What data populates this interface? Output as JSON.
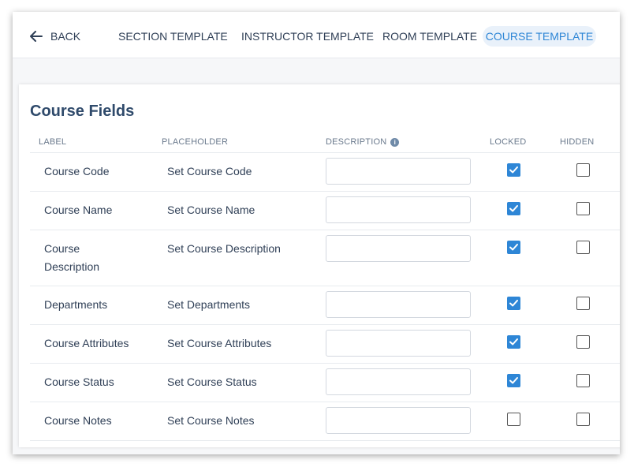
{
  "nav": {
    "back_label": "BACK",
    "tabs": [
      {
        "label": "SECTION TEMPLATE"
      },
      {
        "label": "INSTRUCTOR TEMPLATE"
      },
      {
        "label": "ROOM TEMPLATE"
      },
      {
        "label": "COURSE TEMPLATE",
        "active": true
      }
    ]
  },
  "card": {
    "title": "Course Fields",
    "columns": {
      "label": "LABEL",
      "placeholder": "PLACEHOLDER",
      "description": "DESCRIPTION",
      "locked": "LOCKED",
      "hidden": "HIDDEN"
    },
    "rows": [
      {
        "label": "Course Code",
        "placeholder": "Set Course Code",
        "description": "",
        "locked": true,
        "hidden": false
      },
      {
        "label": "Course Name",
        "placeholder": "Set Course Name",
        "description": "",
        "locked": true,
        "hidden": false
      },
      {
        "label": "Course Description",
        "placeholder": "Set Course Description",
        "description": "",
        "locked": true,
        "hidden": false
      },
      {
        "label": "Departments",
        "placeholder": "Set Departments",
        "description": "",
        "locked": true,
        "hidden": false
      },
      {
        "label": "Course Attributes",
        "placeholder": "Set Course Attributes",
        "description": "",
        "locked": true,
        "hidden": false
      },
      {
        "label": "Course Status",
        "placeholder": "Set Course Status",
        "description": "",
        "locked": true,
        "hidden": false
      },
      {
        "label": "Course Notes",
        "placeholder": "Set Course Notes",
        "description": "",
        "locked": false,
        "hidden": false
      }
    ]
  },
  "colors": {
    "accent": "#2e86d6",
    "active_tab_bg": "#e9f1fa",
    "text": "#2f3f56",
    "title": "#2f4a6b"
  },
  "icons": {
    "back": "arrow-left-icon",
    "info": "info-icon",
    "check": "checkmark-icon"
  }
}
